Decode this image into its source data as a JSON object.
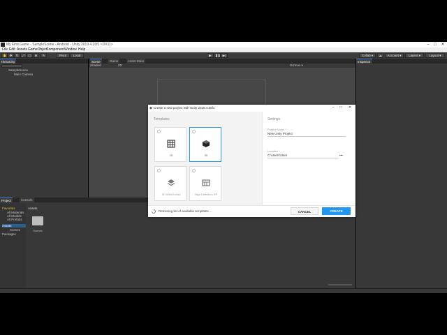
{
  "window": {
    "title": "My First Game - SampleScene - Android - Unity 2019.4.20f1 <DX11>",
    "minimize": "–",
    "maximize": "□",
    "close": "✕"
  },
  "menu": [
    "File",
    "Edit",
    "Assets",
    "GameObject",
    "Component",
    "Window",
    "Help"
  ],
  "toolbar": {
    "pivot": "Pivot",
    "local": "Local",
    "collab": "Collab ▾",
    "account": "Account ▾",
    "layers": "Layers ▾",
    "layout": "Layout ▾"
  },
  "hierarchy": {
    "tab": "Hierarchy",
    "scene": "SampleScene",
    "items": [
      "Main Camera"
    ]
  },
  "scene_tabs": [
    "Scene",
    "Game",
    "Asset Store"
  ],
  "scene_toolbar": {
    "shading": "Shaded",
    "mode2d": "2D",
    "gizmos": "Gizmos ▾"
  },
  "inspector": {
    "tab": "Inspector"
  },
  "project": {
    "tabs": [
      "Project",
      "Console"
    ],
    "favorites": "Favorites",
    "favorite_items": [
      "All Materials",
      "All Models",
      "All Prefabs"
    ],
    "assets": "Assets",
    "asset_children": [
      "Scenes"
    ],
    "packages": "Packages",
    "breadcrumb": "Assets",
    "folder_label": "Scenes"
  },
  "dialog": {
    "title": "Create a new project with Unity 2019.4.20f1",
    "templates_heading": "Templates",
    "templates": [
      {
        "label": "2D",
        "icon": "grid-icon",
        "selected": false
      },
      {
        "label": "3D",
        "icon": "cube-icon",
        "selected": true
      },
      {
        "label": "3D With Extras",
        "icon": "layers-icon",
        "selected": false
      },
      {
        "label": "High Definition RP",
        "icon": "hdrp-icon",
        "selected": false
      }
    ],
    "settings_heading": "Settings",
    "project_name_label": "Project Name *",
    "project_name_value": "New Unity Project",
    "location_label": "Location *",
    "location_value": "C:\\Users\\User",
    "location_browse": "•••",
    "status": "Retrieving list of available templates ...",
    "cancel": "CANCEL",
    "create": "CREATE"
  },
  "colors": {
    "accent": "#2196f3",
    "editor_bg": "#383838",
    "scene_bg": "#474747"
  }
}
